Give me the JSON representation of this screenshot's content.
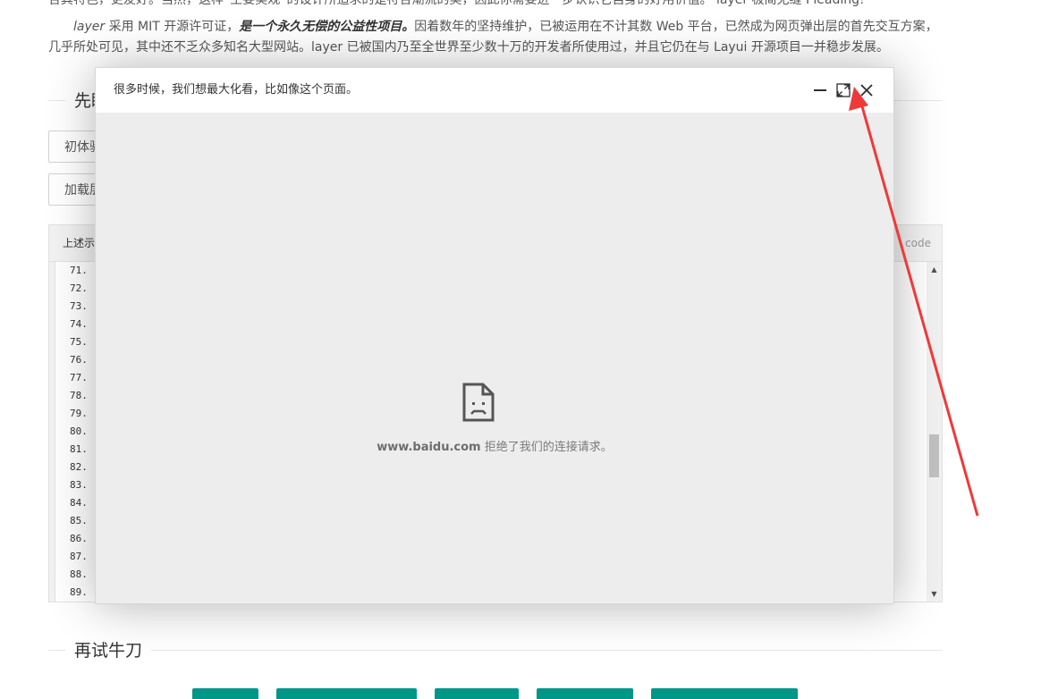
{
  "intro": {
    "line0": "合其特色，更友好。当然，这样“主要美观”的设计所追求的是符合潮流的美，因此你需要进一步认识它自身的好用价值。 layer 极简无缝 Pleading!",
    "line1_prefix": "layer",
    "line1_a": " 采用 MIT 开源许可证，",
    "line1_bold": "是一个永久无偿的公益性项目。",
    "line1_b": "因着数年的坚持维护，已被运用在不计其数 Web 平台，已然成为网页弹出层的首先交互方案，",
    "line2": "几乎所处可见，其中还不乏众多知名大型网站。layer 已被国内乃至全世界至少数十万的开发者所使用过，并且它仍在与 Layui 开源项目一并稳步发展。"
  },
  "sections": {
    "first_title": "先睹",
    "second_title": "再试牛刀"
  },
  "demo_buttons": [
    "初体验",
    "加载层"
  ],
  "code_panel": {
    "header": "上述示",
    "tag": "code",
    "line_numbers": [
      "71.",
      "72.",
      "73.",
      "74.",
      "75.",
      "76.",
      "77.",
      "78.",
      "79.",
      "80.",
      "81.",
      "82.",
      "83.",
      "84.",
      "85.",
      "86.",
      "87.",
      "88.",
      "89."
    ]
  },
  "layer": {
    "title": "很多时候，我们想最大化看，比如像这个页面。",
    "error_host": "www.baidu.com",
    "error_message": " 拒绝了我们的连接请求。"
  },
  "colors": {
    "accent_green": "#009688",
    "annotation_red": "#ef3939",
    "iframe_bg": "#ededed"
  }
}
